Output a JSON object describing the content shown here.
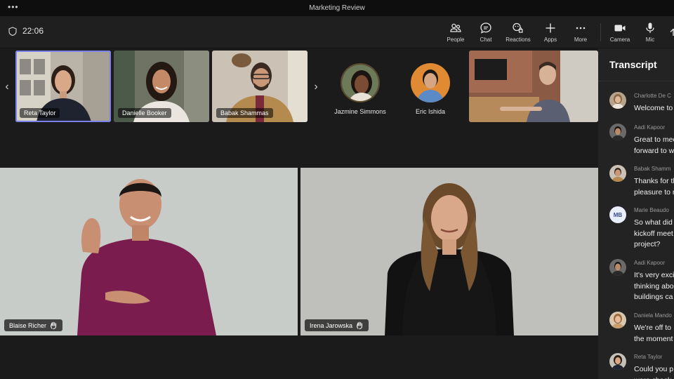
{
  "window": {
    "title": "Marketing Review",
    "menu_glyph": "•••"
  },
  "meeting": {
    "time": "22:06"
  },
  "toolbar": {
    "people": "People",
    "chat": "Chat",
    "reactions": "Reactions",
    "apps": "Apps",
    "more": "More",
    "camera": "Camera",
    "mic": "Mic"
  },
  "strip": {
    "participants": [
      {
        "name": "Reta Taylor",
        "selected": true
      },
      {
        "name": "Danielle Booker"
      },
      {
        "name": "Babak Shammas"
      },
      {
        "name": "Jazmine Simmons"
      },
      {
        "name": "Eric Ishida"
      }
    ]
  },
  "stage": {
    "left": {
      "name": "Blaise Richer",
      "raise_icon": "raised-hand-icon"
    },
    "right": {
      "name": "Irena Jarowska",
      "raise_icon": "raised-hand-icon"
    }
  },
  "transcript": {
    "title": "Transcript",
    "messages": [
      {
        "speaker": "Charlotte De C",
        "text": "Welcome to"
      },
      {
        "speaker": "Aadi Kapoor",
        "text": "Great to mee\nforward to w"
      },
      {
        "speaker": "Babak Shamm",
        "text": "Thanks for th\npleasure to n"
      },
      {
        "speaker": "Marie Beaudo",
        "initials": "MB",
        "text": "So what did\nkickoff meet\nproject?"
      },
      {
        "speaker": "Aadi Kapoor",
        "text": "It's very exci\nthinking abo\nbuildings ca"
      },
      {
        "speaker": "Daniela Mando",
        "text": "We're off to\nthe moment"
      },
      {
        "speaker": "Reta Taylor",
        "text": "Could you p\nwere check"
      }
    ]
  },
  "colors": {
    "accent": "#7b83eb",
    "bg": "#1b1b1b",
    "panel": "#232323"
  }
}
